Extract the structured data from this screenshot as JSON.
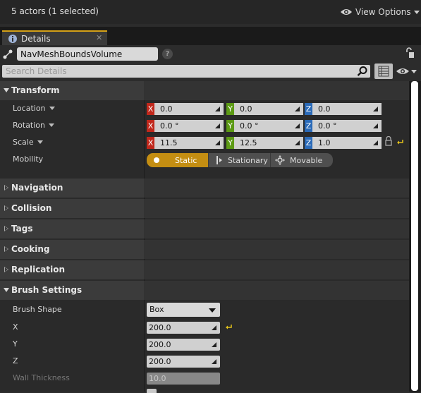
{
  "header": {
    "selection_status": "5 actors (1 selected)",
    "view_options_label": "View Options"
  },
  "tab": {
    "label": "Details"
  },
  "actor": {
    "name": "NavMeshBoundsVolume"
  },
  "search": {
    "placeholder": "Search Details",
    "value": ""
  },
  "transform": {
    "title": "Transform",
    "location": {
      "label": "Location",
      "x": "0.0",
      "y": "0.0",
      "z": "0.0"
    },
    "rotation": {
      "label": "Rotation",
      "x": "0.0 °",
      "y": "0.0 °",
      "z": "0.0 °"
    },
    "scale": {
      "label": "Scale",
      "x": "11.5",
      "y": "12.5",
      "z": "1.0"
    },
    "mobility": {
      "label": "Mobility",
      "options": [
        "Static",
        "Stationary",
        "Movable"
      ],
      "selected": "Static"
    },
    "axis_labels": {
      "x": "X",
      "y": "Y",
      "z": "Z"
    }
  },
  "categories": {
    "navigation": "Navigation",
    "collision": "Collision",
    "tags": "Tags",
    "cooking": "Cooking",
    "replication": "Replication",
    "brush_settings": "Brush Settings"
  },
  "brush": {
    "shape_label": "Brush Shape",
    "shape_value": "Box",
    "x_label": "X",
    "x_value": "200.0",
    "y_label": "Y",
    "y_value": "200.0",
    "z_label": "Z",
    "z_value": "200.0",
    "wall_thickness_label": "Wall Thickness",
    "wall_thickness_value": "10.0"
  },
  "colors": {
    "accent_static": "#c48e12",
    "axis_x": "#c0271b",
    "axis_y": "#5c9a14",
    "axis_z": "#2a6ab8",
    "tab_highlight": "#d4a017"
  },
  "icons": [
    "eye-icon",
    "details-tab-icon",
    "close-icon",
    "actor-icon",
    "help-icon",
    "lock-icon",
    "search-icon",
    "grid-filter-icon",
    "reset-arrow-icon",
    "stationary-icon",
    "movable-icon"
  ]
}
